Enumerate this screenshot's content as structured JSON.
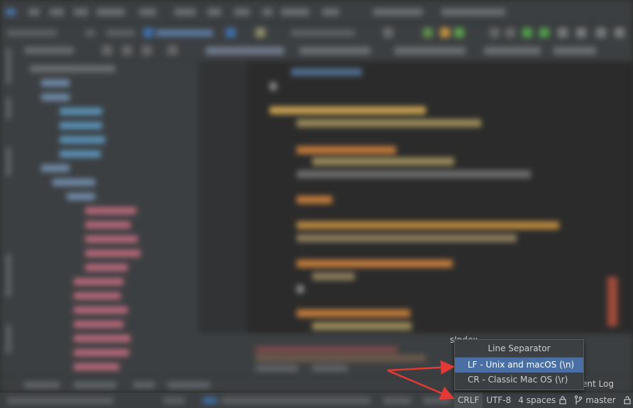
{
  "popup": {
    "title": "Line Separator",
    "options": [
      {
        "label": "LF - Unix and macOS (\\n)",
        "selected": true
      },
      {
        "label": "CR - Classic Mac OS (\\r)",
        "selected": false
      }
    ]
  },
  "status_bar": {
    "line_separator": "CRLF",
    "encoding": "UTF-8",
    "indent": "4 spaces",
    "branch": "master"
  },
  "event_log": "ent Log",
  "editor_overlay_text": "sIndex",
  "colors": {
    "arrow": "#e53935",
    "selection": "#4a6fa5",
    "popup_bg": "#3c3f41"
  }
}
